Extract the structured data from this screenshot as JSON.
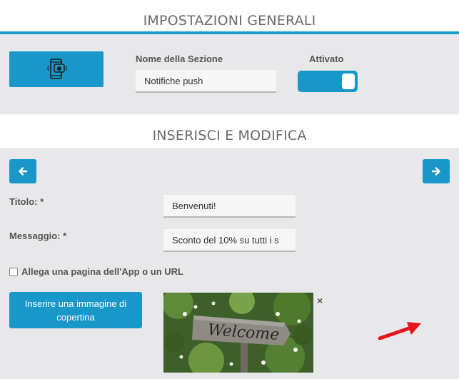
{
  "general": {
    "title": "IMPOSTAZIONI GENERALI",
    "section_name_label": "Nome della Sezione",
    "section_name_value": "Notifiche push",
    "active_label": "Attivato",
    "active_on": true,
    "section_icon": "phone-notification-icon"
  },
  "edit": {
    "title": "INSERISCI E MODIFICA",
    "prev_icon": "arrow-left-icon",
    "next_icon": "arrow-right-icon",
    "title_label": "Titolo: *",
    "title_value": "Benvenuti!",
    "message_label": "Messaggio: *",
    "message_value": "Sconto del 10% su tutti i s",
    "attach_label": "Allega una pagina dell'App o un URL",
    "attach_checked": false,
    "cover_button_label": "Inserire una immagine di copertina",
    "cover_image_text": "Welcome",
    "remove_image": "×"
  },
  "colors": {
    "accent": "#1a97c9",
    "panel_bg": "#e8e8eb",
    "annotation_arrow": "#e8141c"
  }
}
